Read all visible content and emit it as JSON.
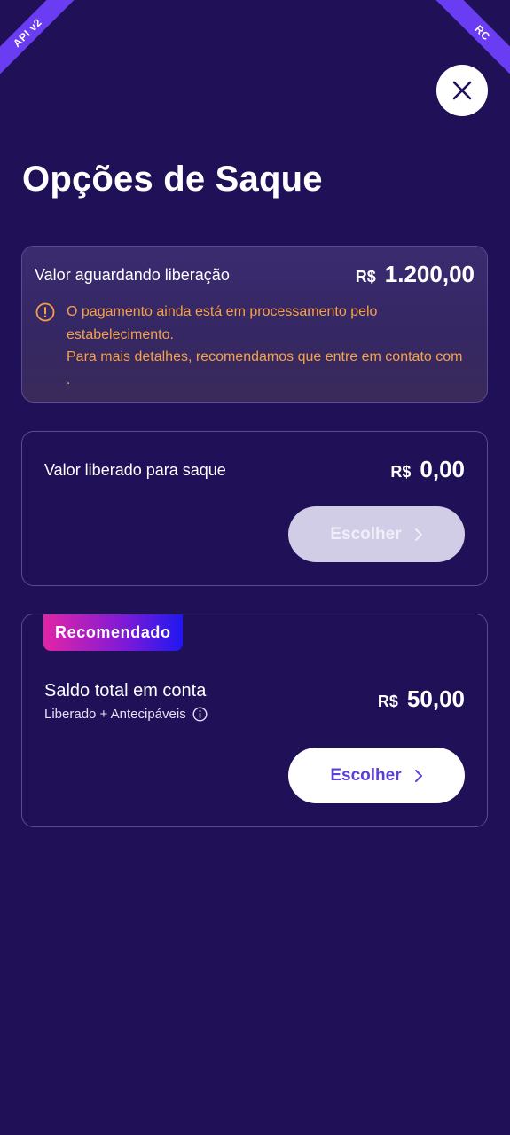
{
  "debug": {
    "left_ribbon": "API v2",
    "right_ribbon": "RC"
  },
  "header": {
    "title": "Opções de Saque",
    "close_icon": "close-icon"
  },
  "pending": {
    "label": "Valor aguardando liberação",
    "currency": "R$",
    "amount": "1.200,00",
    "warning_icon": "alert-circle-icon",
    "warning_line1": "O pagamento ainda está em processamento pelo estabelecimento.",
    "warning_line2": "Para mais detalhes, recomendamos que entre em contato com ."
  },
  "released": {
    "label": "Valor liberado para saque",
    "currency": "R$",
    "amount": "0,00",
    "button_label": "Escolher",
    "button_disabled": true
  },
  "recommended": {
    "badge": "Recomendado",
    "label": "Saldo total em conta",
    "sublabel": "Liberado + Antecipáveis",
    "info_icon": "info-icon",
    "currency": "R$",
    "amount": "50,00",
    "button_label": "Escolher"
  },
  "colors": {
    "background": "#1f1058",
    "warning": "#f5a14a",
    "accent": "#5a3fd8",
    "badge_gradient_start": "#e224a6",
    "badge_gradient_end": "#1f18f0"
  }
}
